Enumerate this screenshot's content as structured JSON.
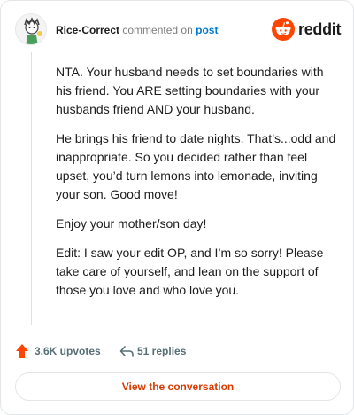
{
  "comment": {
    "username": "Rice-Correct",
    "action": "commented on",
    "post_link": "post",
    "paragraphs": [
      "NTA. Your husband needs to set boundaries with his friend. You ARE setting boundaries with your husbands friend AND your husband.",
      "He brings his friend to date nights. That’s...odd and inappropriate. So you decided rather than feel upset, you’d turn lemons into lemonade, inviting your son. Good move!",
      "Enjoy your mother/son day!",
      "Edit: I saw your edit OP, and I’m so sorry! Please take care of yourself, and lean on the support of those you love and who love you."
    ]
  },
  "brand": {
    "name": "reddit",
    "icon": "reddit-snoo-icon",
    "color": "#ff4500"
  },
  "actions": {
    "upvotes": "3.6K upvotes",
    "upvote_icon": "upvote-arrow-icon",
    "upvote_color": "#ff4500",
    "replies": "51 replies",
    "reply_icon": "reply-arrow-icon"
  },
  "cta": {
    "label": "View the conversation",
    "color": "#d93a00"
  }
}
